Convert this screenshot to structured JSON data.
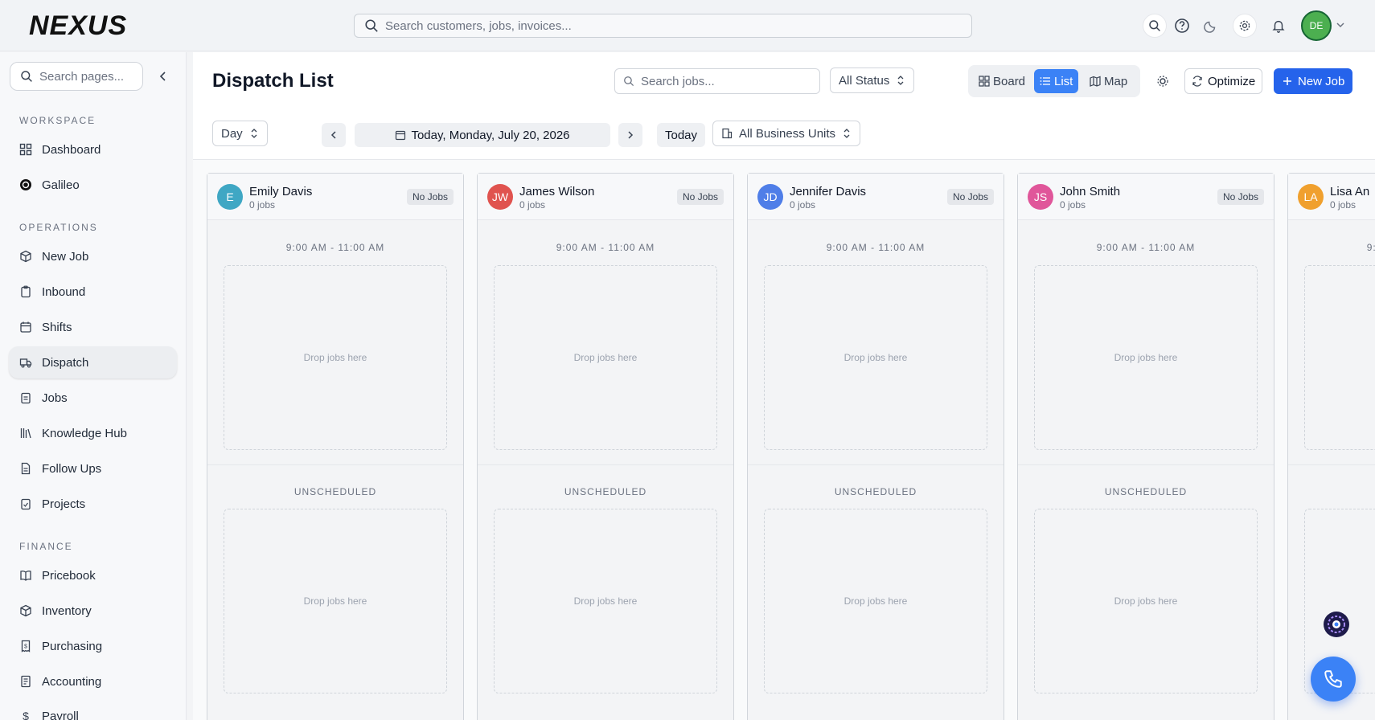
{
  "app": {
    "logo_text": "NEXUS"
  },
  "topbar": {
    "search_placeholder": "Search customers, jobs, invoices...",
    "icons": [
      "search-icon",
      "help-icon",
      "moon-icon",
      "gear-icon",
      "bell-icon"
    ],
    "user_initials": "DE"
  },
  "sidebar": {
    "search_placeholder": "Search pages...",
    "sections": [
      {
        "title": "WORKSPACE",
        "items": [
          {
            "label": "Dashboard",
            "icon": "grid-icon"
          },
          {
            "label": "Galileo",
            "icon": "galileo-icon"
          }
        ]
      },
      {
        "title": "OPERATIONS",
        "items": [
          {
            "label": "New Job",
            "icon": "box-icon"
          },
          {
            "label": "Inbound",
            "icon": "clipboard-icon"
          },
          {
            "label": "Shifts",
            "icon": "calendar-icon"
          },
          {
            "label": "Dispatch",
            "icon": "truck-icon",
            "active": true
          },
          {
            "label": "Jobs",
            "icon": "clipboard-list-icon"
          },
          {
            "label": "Knowledge Hub",
            "icon": "library-icon"
          },
          {
            "label": "Follow Ups",
            "icon": "file-icon"
          },
          {
            "label": "Projects",
            "icon": "clipboard-check-icon"
          }
        ]
      },
      {
        "title": "FINANCE",
        "items": [
          {
            "label": "Pricebook",
            "icon": "book-icon"
          },
          {
            "label": "Inventory",
            "icon": "package-icon"
          },
          {
            "label": "Purchasing",
            "icon": "receipt-icon"
          },
          {
            "label": "Accounting",
            "icon": "ledger-icon"
          },
          {
            "label": "Payroll",
            "icon": "dollar-icon"
          }
        ]
      }
    ]
  },
  "main": {
    "title": "Dispatch List",
    "job_search_placeholder": "Search jobs...",
    "status_filter": "All Status",
    "views": {
      "board": "Board",
      "list": "List",
      "map": "Map",
      "active": "List"
    },
    "optimize_label": "Optimize",
    "new_job_label": "New Job",
    "range_select": "Day",
    "date_label": "Today, Monday, July 20, 2026",
    "today_label": "Today",
    "business_units": "All Business Units"
  },
  "board": {
    "time_slot": "9:00 AM - 11:00 AM",
    "unscheduled_label": "UNSCHEDULED",
    "drop_label": "Drop jobs here",
    "technicians": [
      {
        "initials": "E",
        "name": "Emily Davis",
        "jobs": "0 jobs",
        "badge": "No Jobs",
        "color": "#3fa7c4"
      },
      {
        "initials": "JW",
        "name": "James Wilson",
        "jobs": "0 jobs",
        "badge": "No Jobs",
        "color": "#e0534f"
      },
      {
        "initials": "JD",
        "name": "Jennifer Davis",
        "jobs": "0 jobs",
        "badge": "No Jobs",
        "color": "#4f7ee8"
      },
      {
        "initials": "JS",
        "name": "John Smith",
        "jobs": "0 jobs",
        "badge": "No Jobs",
        "color": "#e0569a"
      },
      {
        "initials": "LA",
        "name": "Lisa An",
        "jobs": "0 jobs",
        "badge": "",
        "color": "#f0a02e"
      }
    ]
  },
  "colors": {
    "primary": "#2563eb",
    "active_toggle": "#3b82f6"
  }
}
